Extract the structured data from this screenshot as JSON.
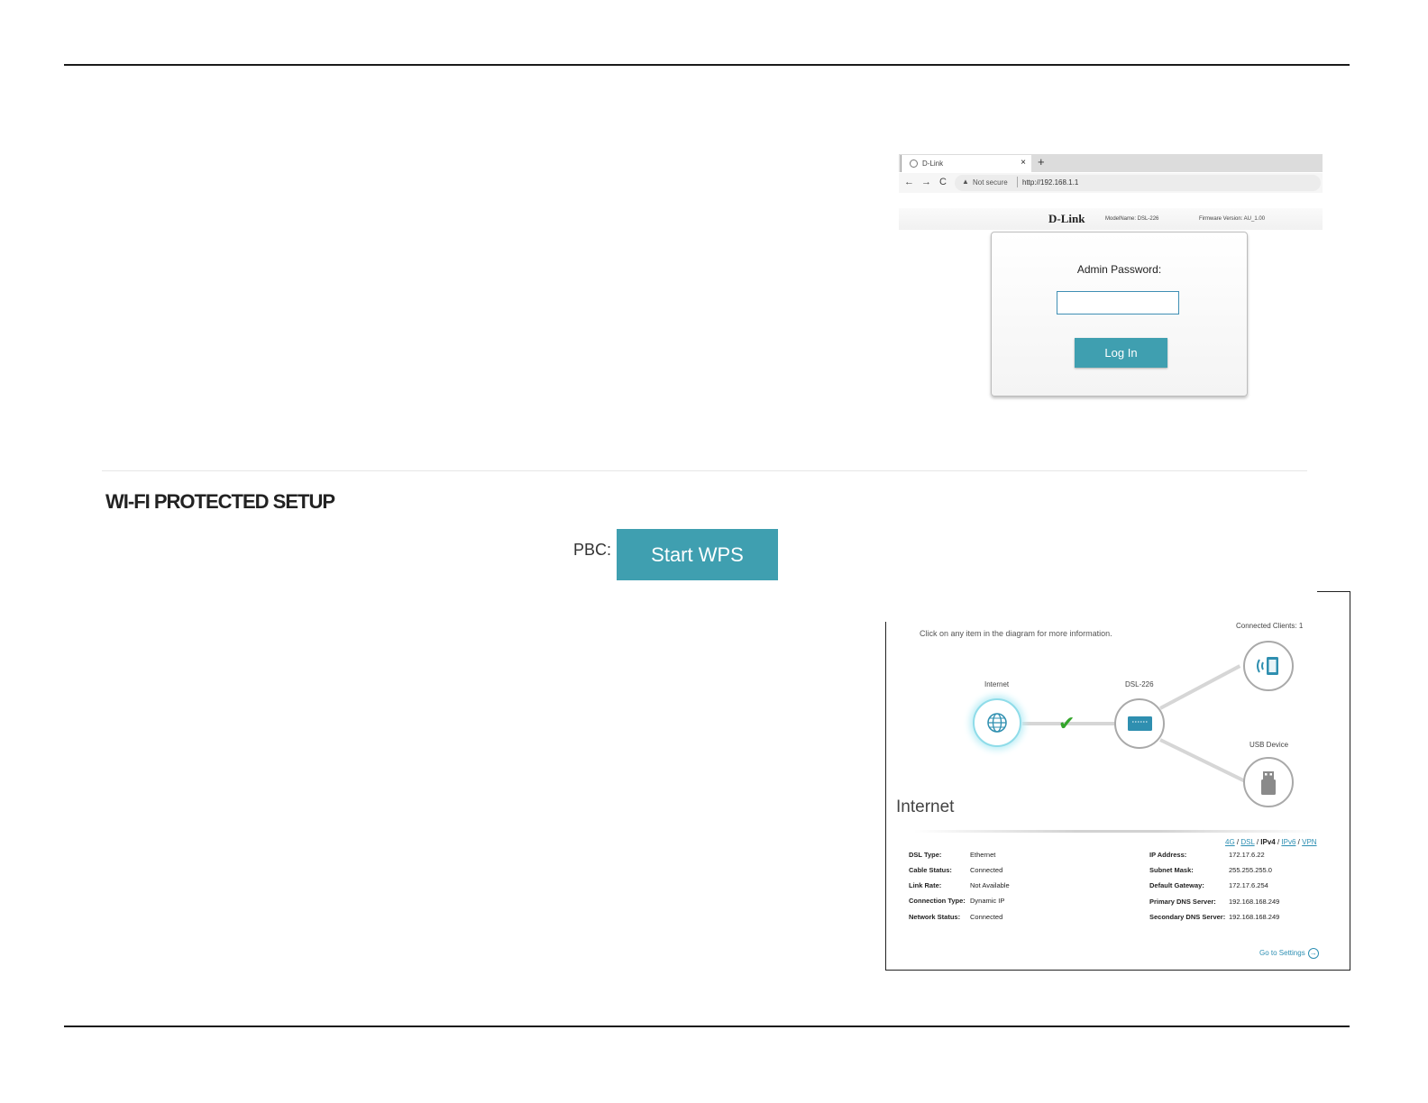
{
  "browser": {
    "tab_title": "D-Link",
    "tab_close": "×",
    "new_tab": "+",
    "nav_back": "←",
    "nav_forward": "→",
    "nav_reload": "C",
    "security_warning": "▲",
    "security_text": "Not secure",
    "url": "http://192.168.1.1"
  },
  "router_login": {
    "brand": "D-Link",
    "model_name": "ModelName: DSL-226",
    "firmware": "Firmware Version: AU_1.00",
    "password_label": "Admin Password:",
    "password_value": "",
    "login_button": "Log In"
  },
  "wps": {
    "title": "WI-FI PROTECTED SETUP",
    "pbc_label": "PBC:",
    "start_button": "Start WPS"
  },
  "network_map": {
    "hint": "Click on any item in the diagram for more information.",
    "connected_clients": "Connected Clients: 1",
    "internet_label": "Internet",
    "router_label": "DSL-226",
    "usb_label": "USB Device",
    "section_title": "Internet",
    "protocols": [
      "4G",
      "DSL",
      "IPv4",
      "IPv6",
      "VPN"
    ],
    "active_protocol": "IPv4",
    "left_details": [
      {
        "key": "DSL Type:",
        "value": "Ethernet"
      },
      {
        "key": "Cable Status:",
        "value": "Connected"
      },
      {
        "key": "Link Rate:",
        "value": "Not Available"
      },
      {
        "key": "Connection Type:",
        "value": "Dynamic IP"
      },
      {
        "key": "Network Status:",
        "value": "Connected"
      }
    ],
    "right_details": [
      {
        "key": "IP Address:",
        "value": "172.17.6.22"
      },
      {
        "key": "Subnet Mask:",
        "value": "255.255.255.0"
      },
      {
        "key": "Default Gateway:",
        "value": "172.17.6.254"
      },
      {
        "key": "Primary DNS Server:",
        "value": "192.168.168.249"
      },
      {
        "key": "Secondary DNS Server:",
        "value": "192.168.168.249"
      }
    ],
    "go_to_settings": "Go to Settings",
    "go_to_settings_arrow": "→"
  }
}
